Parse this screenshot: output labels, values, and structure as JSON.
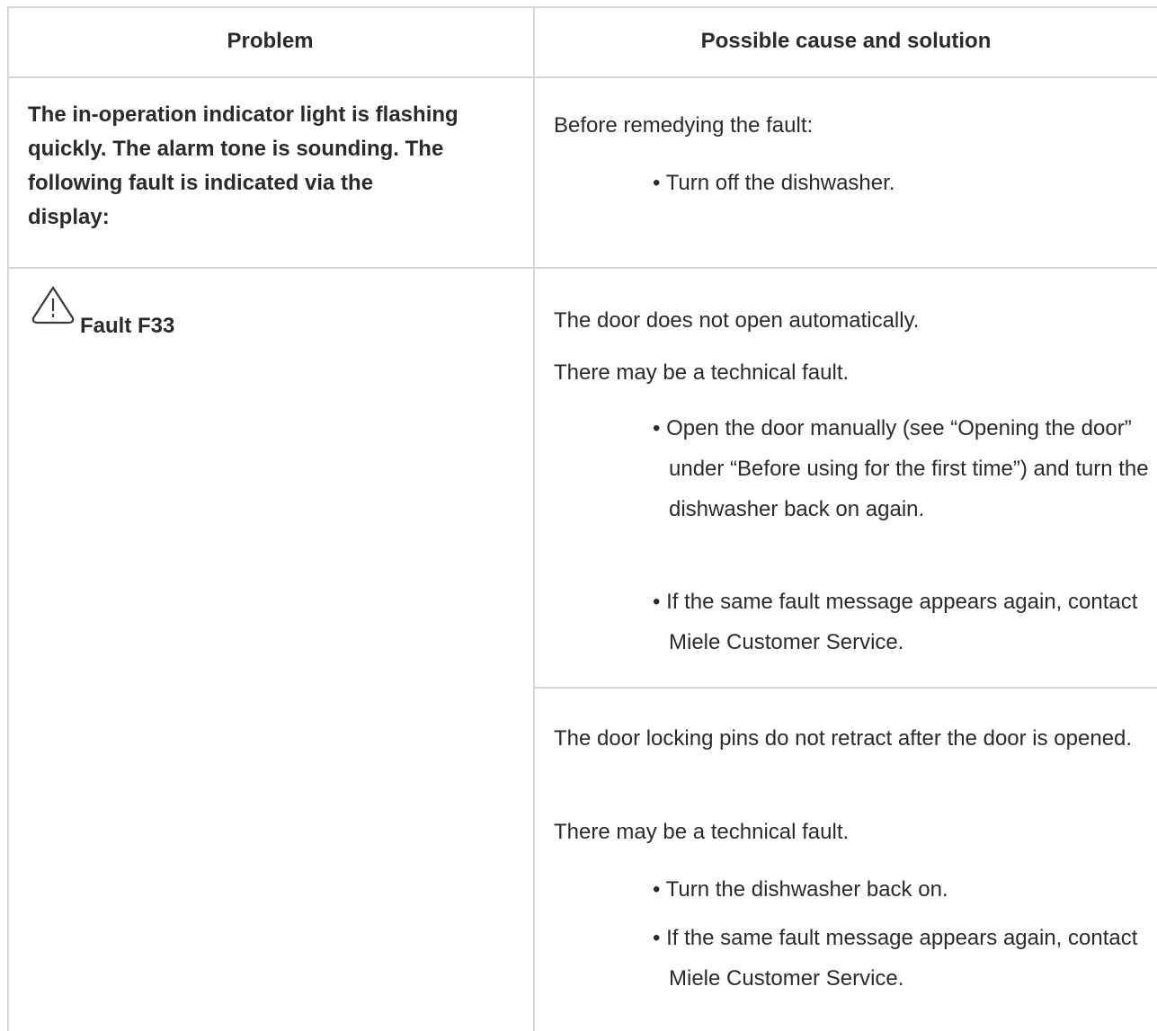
{
  "table": {
    "header": {
      "problem": "Problem",
      "solution": "Possible cause and solution"
    },
    "row1": {
      "problem": "The in-operation indicator light is flashing quickly. The alarm tone is sounding. The following fault is indicated via the display:",
      "intro": "Before remedying the fault:",
      "bullet": "• Turn off the dishwasher."
    },
    "row2": {
      "icon": "warning-triangle-icon",
      "problem": "Fault F33",
      "cause1": {
        "line1": "The door does not open automatically.",
        "line2": "There may be a technical fault.",
        "bullet1": "• Open the door manually (see “Opening the door” under “Before using for the first time”) and turn the dishwasher back on again.",
        "bullet2": "• If the same fault message appears again, contact Miele Customer Service."
      },
      "cause2": {
        "line1": "The door locking pins do not retract after the door is opened.",
        "line2": "There may be a technical fault.",
        "bullet1": "• Turn the dishwasher back on.",
        "bullet2": "• If the same fault message appears again, contact Miele Customer Service."
      }
    }
  }
}
